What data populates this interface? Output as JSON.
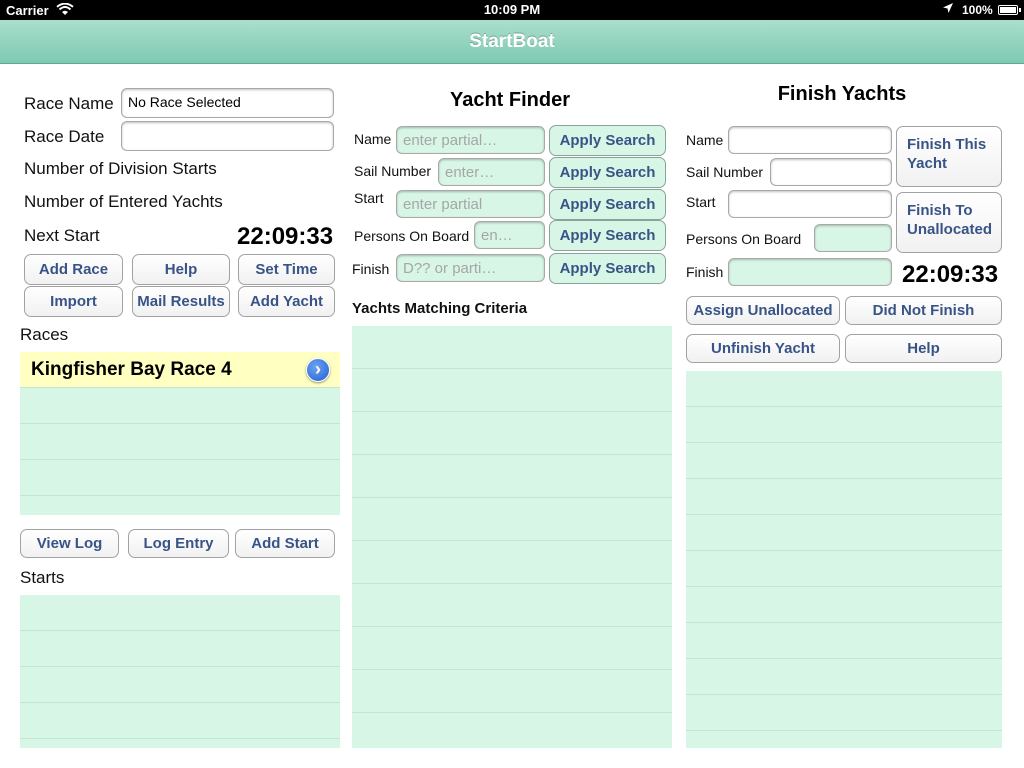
{
  "status_bar": {
    "carrier": "Carrier",
    "time": "10:09 PM",
    "battery": "100%"
  },
  "nav": {
    "title": "StartBoat"
  },
  "race_panel": {
    "race_name_label": "Race Name",
    "race_name_value": "No Race Selected",
    "race_date_label": "Race Date",
    "race_date_value": "",
    "division_starts_label": "Number of Division Starts",
    "entered_yachts_label": "Number of Entered Yachts",
    "next_start_label": "Next Start",
    "next_start_time": "22:09:33",
    "buttons": {
      "add_race": "Add Race",
      "help": "Help",
      "set_time": "Set Time",
      "import": "Import",
      "mail_results": "Mail Results",
      "add_yacht": "Add Yacht"
    },
    "races_label": "Races",
    "races": [
      "Kingfisher Bay Race 4"
    ],
    "bottom_buttons": {
      "view_log": "View Log",
      "log_entry": "Log Entry",
      "add_start": "Add Start"
    },
    "starts_label": "Starts"
  },
  "yacht_finder": {
    "title": "Yacht Finder",
    "name_label": "Name",
    "name_placeholder": "enter partial…",
    "sail_label": "Sail Number",
    "sail_placeholder": "enter…",
    "start_label": "Start",
    "start_placeholder": "enter partial",
    "pob_label": "Persons On Board",
    "pob_placeholder": "en…",
    "finish_label": "Finish",
    "finish_placeholder": "D?? or parti…",
    "apply_label": "Apply Search",
    "results_label": "Yachts Matching Criteria"
  },
  "finish_yachts": {
    "title": "Finish Yachts",
    "name_label": "Name",
    "sail_label": "Sail Number",
    "start_label": "Start",
    "pob_label": "Persons On Board",
    "finish_label": "Finish",
    "time": "22:09:33",
    "finish_this_yacht": "Finish This Yacht",
    "finish_to_unallocated": "Finish To Unallocated",
    "assign_unallocated": "Assign Unallocated",
    "did_not_finish": "Did Not Finish",
    "unfinish_yacht": "Unfinish Yacht",
    "help": "Help"
  }
}
